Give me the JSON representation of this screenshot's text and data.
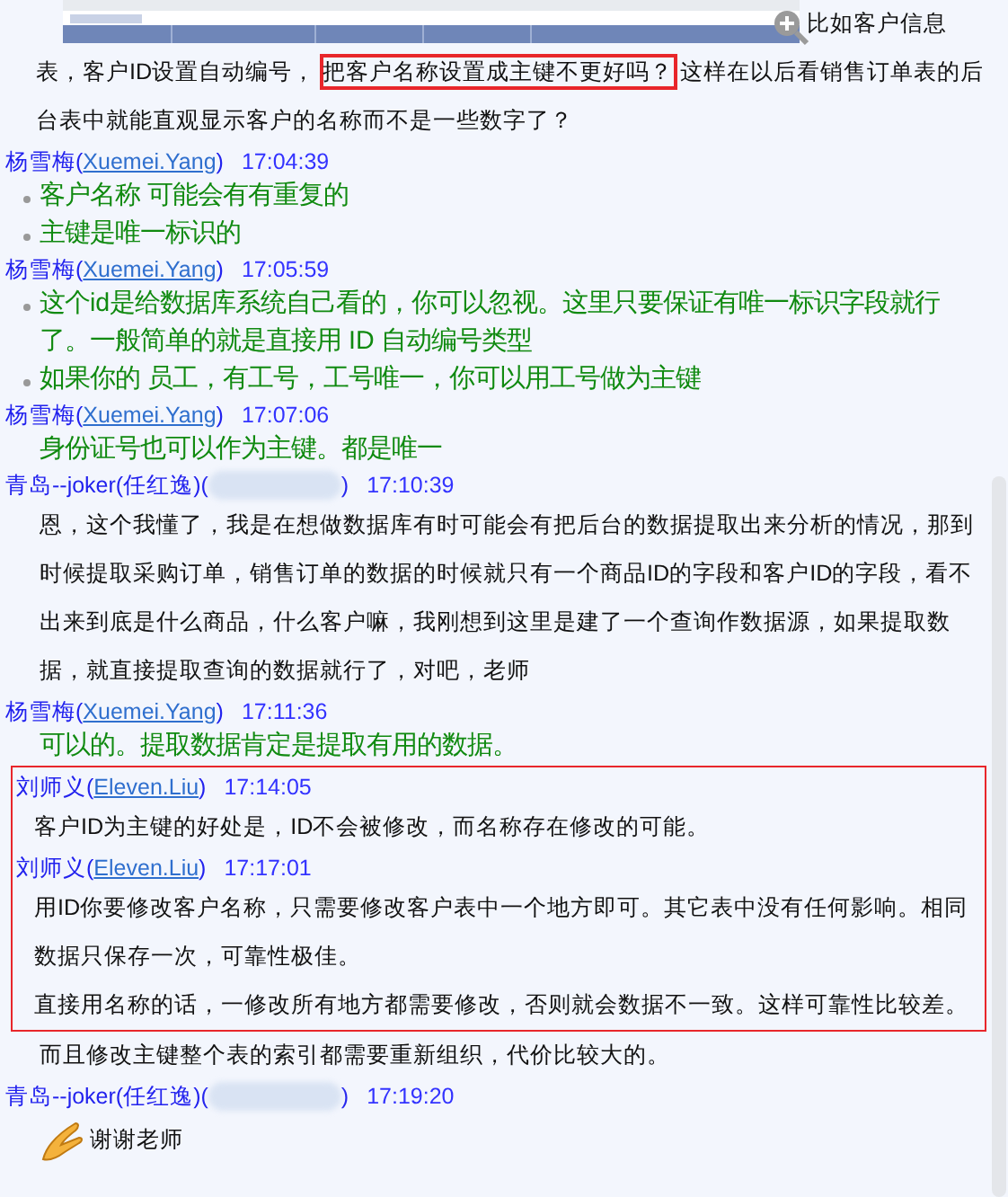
{
  "intro": {
    "kind": "picture",
    "zoomable": true,
    "segments": [
      {
        "text": "比如客户信息表，客户ID设置自动编号，",
        "boxed": false
      },
      {
        "text": "把客户名称设置成主键不更好吗？",
        "boxed": true
      },
      {
        "text": "这样在以后看销售订单表的后台表中就能直观显示客户的名称而不是一些数字了？",
        "boxed": false
      }
    ]
  },
  "blocks": [
    {
      "kind": "message",
      "name": "杨雪梅(",
      "handle": "Xuemei.Yang",
      "close": ")",
      "time": "17:04:39",
      "body": {
        "kind": "bullets",
        "lines": [
          "客户名称  可能会有有重复的",
          "主键是唯一标识的"
        ]
      }
    },
    {
      "kind": "message",
      "name": "杨雪梅(",
      "handle": "Xuemei.Yang",
      "close": ")",
      "time": "17:05:59",
      "body": {
        "kind": "bullets",
        "lines": [
          "这个id是给数据库系统自己看的，你可以忽视。这里只要保证有唯一标识字段就行了。一般简单的就是直接用 ID 自动编号类型",
          "如果你的 员工，有工号，工号唯一，你可以用工号做为主键"
        ]
      }
    },
    {
      "kind": "message",
      "name": "杨雪梅(",
      "handle": "Xuemei.Yang",
      "close": ")",
      "time": "17:07:06",
      "body": {
        "kind": "green",
        "lines": [
          "身份证号也可以作为主键。都是唯一"
        ]
      }
    },
    {
      "kind": "message",
      "name": "青岛--joker(任红逸)(",
      "redacted": true,
      "close": ")",
      "time": "17:10:39",
      "body": {
        "kind": "plain",
        "lines": [
          "恩，这个我懂了，我是在想做数据库有时可能会有把后台的数据提取出来分析的情况，那到时候提取采购订单，销售订单的数据的时候就只有一个商品ID的字段和客户ID的字段，看不出来到底是什么商品，什么客户嘛，我刚想到这里是建了一个查询作数据源，如果提取数据，就直接提取查询的数据就行了，对吧，老师"
        ]
      }
    },
    {
      "kind": "message",
      "name": "杨雪梅(",
      "handle": "Xuemei.Yang",
      "close": ")",
      "time": "17:11:36",
      "body": {
        "kind": "green",
        "lines": [
          "可以的。提取数据肯定是提取有用的数据。"
        ]
      }
    },
    {
      "kind": "boxed",
      "messages": [
        {
          "kind": "message",
          "name": "刘师义(",
          "handle": "Eleven.Liu",
          "close": ")",
          "time": "17:14:05",
          "body": {
            "kind": "plain",
            "lines": [
              "客户ID为主键的好处是，ID不会被修改，而名称存在修改的可能。"
            ]
          }
        },
        {
          "kind": "message",
          "name": "刘师义(",
          "handle": "Eleven.Liu",
          "close": ")",
          "time": "17:17:01",
          "body": {
            "kind": "plain",
            "lines": [
              "用ID你要修改客户名称，只需要修改客户表中一个地方即可。其它表中没有任何影响。相同数据只保存一次，可靠性极佳。",
              "直接用名称的话，一修改所有地方都需要修改，否则就会数据不一致。这样可靠性比较差。"
            ]
          }
        }
      ]
    },
    {
      "kind": "continuation",
      "body": {
        "kind": "plain",
        "lines": [
          "而且修改主键整个表的索引都需要重新组织，代价比较大的。"
        ]
      }
    },
    {
      "kind": "message",
      "name": "青岛--joker(任红逸)(",
      "redacted": true,
      "close": ")",
      "time": "17:19:20",
      "body": {
        "kind": "emoji",
        "lines": [
          "谢谢老师"
        ]
      }
    }
  ]
}
